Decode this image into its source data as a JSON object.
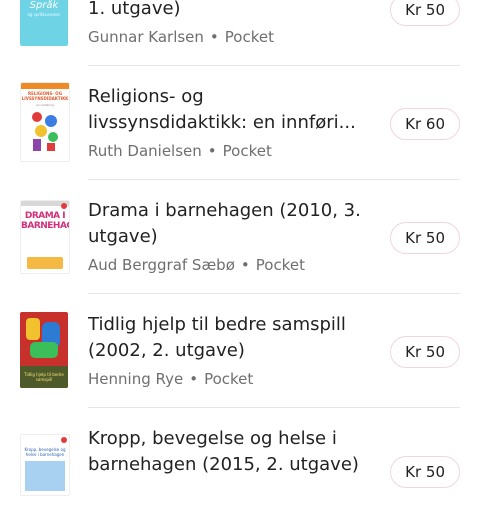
{
  "books": [
    {
      "title": "1. utgave)",
      "author": "Gunnar Karlsen",
      "format": "Pocket",
      "price": "Kr 50",
      "cover_text": "Språk",
      "cover_sub": "og språkvansker"
    },
    {
      "title": "Religions- og livssynsdidaktikk: en innføri...",
      "author": "Ruth Danielsen",
      "format": "Pocket",
      "price": "Kr 60",
      "cover_text": "RELIGIONS- OG LIVSSYNSDIDAKTIKK",
      "cover_sub": "en innføring"
    },
    {
      "title": "Drama i barnehagen (2010, 3. utgave)",
      "author": "Aud Berggraf Sæbø",
      "format": "Pocket",
      "price": "Kr 50",
      "cover_text": "DRAMA I BARNEHAGEN"
    },
    {
      "title": "Tidlig hjelp til bedre samspill (2002, 2. utgave)",
      "author": "Henning Rye",
      "format": "Pocket",
      "price": "Kr 50",
      "cover_text": "Tidlig hjelp til bedre samspill"
    },
    {
      "title": "Kropp, bevegelse og helse i barnehagen (2015, 2. utgave)",
      "author": "",
      "format": "",
      "price": "Kr 50",
      "cover_text": "Kropp, bevegelse og helse i barnehagen"
    }
  ],
  "separator": "•",
  "colors": {
    "price_border": "#f1d6dc",
    "divider": "#e6e6e6",
    "meta_text": "#6f6f6f"
  }
}
